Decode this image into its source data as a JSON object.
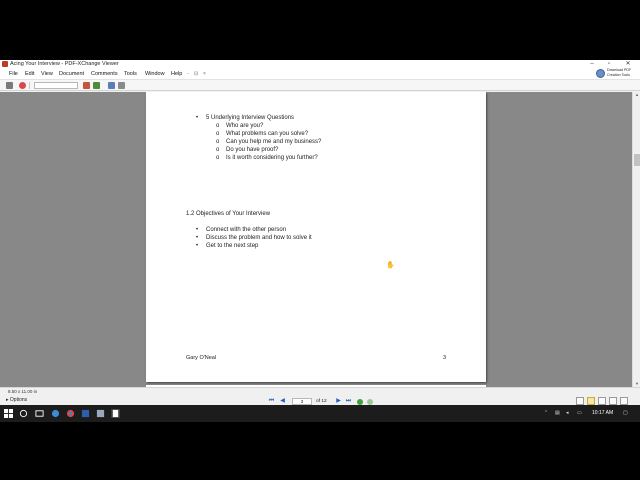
{
  "window": {
    "title": "Acing Your Interview - PDF-XChange Viewer",
    "controls": [
      "–",
      "▫",
      "✕"
    ]
  },
  "menu": {
    "items": [
      "File",
      "Edit",
      "View",
      "Document",
      "Comments",
      "Tools",
      "Window",
      "Help"
    ],
    "extra": [
      "-",
      "⊡",
      "×"
    ]
  },
  "promo": {
    "text": "Download PDF Creation Tools"
  },
  "document": {
    "bullet_glyph": "•",
    "sub_glyph": "o",
    "section1_heading": "5 Underlying Interview Questions",
    "questions": [
      "Who are you?",
      "What problems can you solve?",
      "Can you help me and my business?",
      "Do you have proof?",
      "Is it worth considering you further?"
    ],
    "section2_heading": "1.2  Objectives of Your Interview",
    "objectives": [
      "Connect with the other person",
      "Discuss the problem and how to solve it",
      "Get to the next step"
    ],
    "footer_author": "Gary O'Neal",
    "footer_page": "3"
  },
  "status": {
    "page_size": "8.50 x 11.00 in",
    "options_label": "Options",
    "current_page": "3",
    "page_count": "of 12"
  },
  "taskbar": {
    "time": "10:17 AM"
  },
  "colors": {
    "doc_background": "#888888",
    "nav_blue": "#1f5fbf",
    "taskbar": "#1c1c1c"
  }
}
